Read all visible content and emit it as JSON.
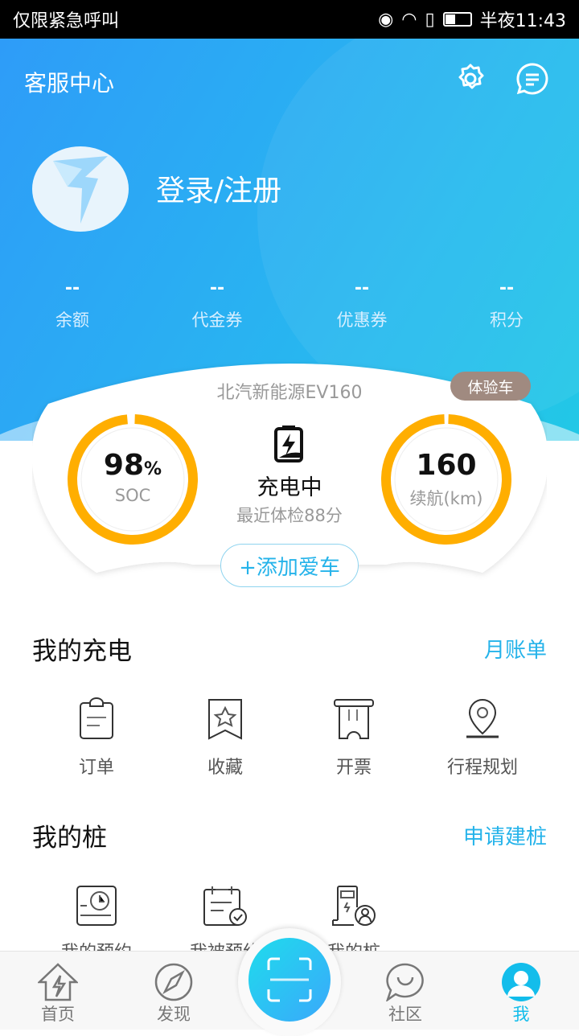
{
  "status_bar": {
    "left": "仅限紧急呼叫",
    "time": "半夜11:43"
  },
  "header": {
    "title": "客服中心",
    "settings_icon": "gear-icon",
    "message_icon": "message-icon"
  },
  "profile": {
    "login_label": "登录/注册",
    "avatar_icon": "logo-icon"
  },
  "stats": [
    {
      "value": "--",
      "label": "余额"
    },
    {
      "value": "--",
      "label": "代金券"
    },
    {
      "value": "--",
      "label": "优惠券"
    },
    {
      "value": "--",
      "label": "积分"
    }
  ],
  "car": {
    "name": "北汽新能源EV160",
    "badge": "体验车",
    "soc_value": "98",
    "soc_unit": "%",
    "soc_label": "SOC",
    "soc_percent": 98,
    "range_value": "160",
    "range_label": "续航(km)",
    "status": "充电中",
    "checkup": "最近体检88分",
    "add_label": "+添加爱车",
    "gauge_color": "#FFAE00"
  },
  "charging": {
    "title": "我的充电",
    "link": "月账单",
    "items": [
      {
        "label": "订单",
        "icon": "clipboard-icon"
      },
      {
        "label": "收藏",
        "icon": "bookmark-star-icon"
      },
      {
        "label": "开票",
        "icon": "receipt-icon"
      },
      {
        "label": "行程规划",
        "icon": "location-pin-icon"
      }
    ]
  },
  "piles": {
    "title": "我的桩",
    "link": "申请建桩",
    "items": [
      {
        "label": "我的预约",
        "icon": "clock-card-icon"
      },
      {
        "label": "我被预约",
        "icon": "calendar-check-icon"
      },
      {
        "label": "我的桩",
        "icon": "charger-user-icon"
      }
    ]
  },
  "nav": {
    "items": [
      {
        "label": "首页",
        "icon": "home-bolt-icon"
      },
      {
        "label": "发现",
        "icon": "compass-icon"
      },
      {
        "label": "社区",
        "icon": "chat-bubble-icon"
      },
      {
        "label": "我",
        "icon": "user-icon"
      }
    ],
    "scan_icon": "scan-icon",
    "active_color": "#13BDEB"
  }
}
